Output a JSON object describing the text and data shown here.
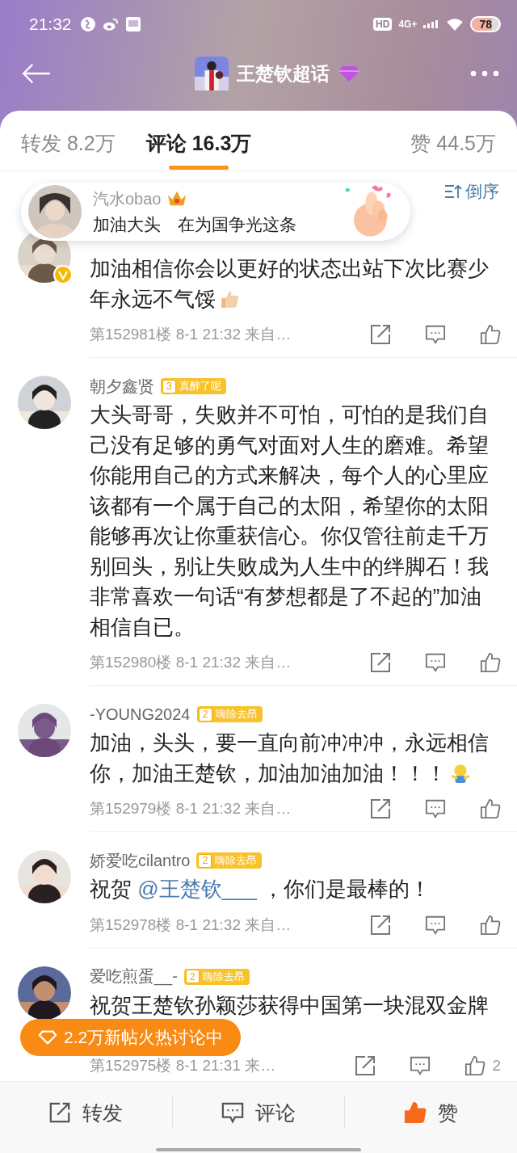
{
  "status_bar": {
    "time": "21:32",
    "hd": "HD",
    "network": "4G+",
    "battery": "78"
  },
  "nav": {
    "title": "王楚钦超话"
  },
  "tabs": [
    {
      "label": "转发",
      "count": "8.2万",
      "selected": false
    },
    {
      "label": "评论",
      "count": "16.3万",
      "selected": true
    },
    {
      "label": "赞",
      "count": "44.5万",
      "selected": false
    }
  ],
  "sort": {
    "label": "倒序"
  },
  "toast": {
    "name": "汽水obao",
    "text": "加油大头　在为国争光这条"
  },
  "comments": [
    {
      "verified": true,
      "parts": [
        {
          "text": "加油相信你会以更好的状态出站下次比赛少年永远不气馁"
        },
        {
          "kind": "thumbs-up"
        }
      ],
      "meta": "第152981楼 8-1 21:32 来自…"
    },
    {
      "verified": false,
      "name": "朝夕鑫贤",
      "level": "3",
      "badge": "真醉了呢",
      "parts": [
        {
          "text": "大头哥哥，失败并不可怕，可怕的是我们自己没有足够的勇气对面对人生的磨难。希望你能用自己的方式来解决，每个人的心里应该都有一个属于自己的太阳，希望你的太阳能够再次让你重获信心。你仅管往前走千万别回头，别让失败成为人生中的绊脚石！我非常喜欢一句话“有梦想都是了不起的”加油相信自已。"
        }
      ],
      "meta": "第152980楼 8-1 21:32 来自…"
    },
    {
      "verified": false,
      "name": "-YOUNG2024",
      "level": "2",
      "badge": "嗨除去昂",
      "parts": [
        {
          "text": "加油，头头，要一直向前冲冲冲，永远相信你，加油王楚钦，加油加油加油！！！"
        },
        {
          "kind": "hug"
        }
      ],
      "meta": "第152979楼 8-1 21:32 来自…"
    },
    {
      "verified": false,
      "name": "娇爱吃cilantro",
      "level": "2",
      "badge": "嗨除去昂",
      "parts": [
        {
          "text": "祝贺 "
        },
        {
          "text": "@王楚钦___",
          "kind": "mention"
        },
        {
          "text": " ，你们是最棒的！"
        }
      ],
      "meta": "第152978楼 8-1 21:32 来自…"
    },
    {
      "verified": false,
      "name": "爱吃煎蛋__-",
      "level": "2",
      "badge": "嗨除去昂",
      "parts": [
        {
          "text": "祝贺王楚钦孙颖莎获得中国第一块混双金牌"
        }
      ],
      "meta": "第152975楼 8-1 21:31 来…",
      "likes": "2"
    }
  ],
  "hot_banner": {
    "text": "2.2万新帖火热讨论中"
  },
  "bottom_bar": [
    {
      "label": "转发",
      "kind": "repost",
      "active": false
    },
    {
      "label": "评论",
      "kind": "comment",
      "active": false
    },
    {
      "label": "赞",
      "kind": "like",
      "active": true
    }
  ]
}
